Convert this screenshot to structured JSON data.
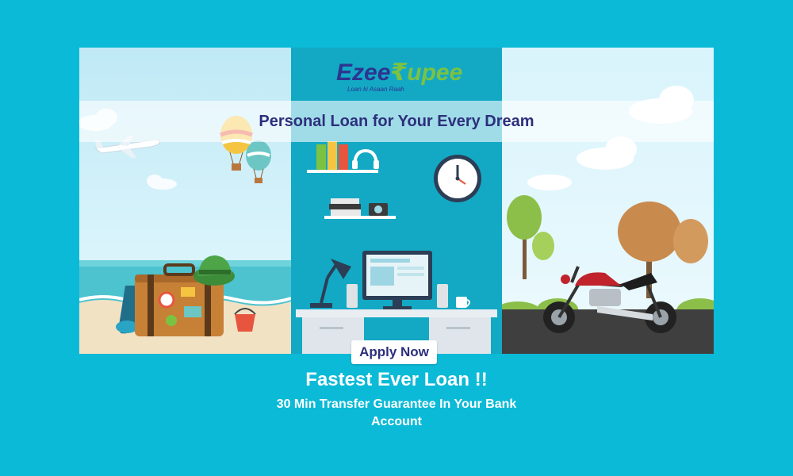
{
  "brand": {
    "logo_part1": "Ezee",
    "logo_part2": "₹upee",
    "logo_tagline": "Loan ki Asaan Raah"
  },
  "banner": {
    "tagline": "Personal Loan for Your Every Dream",
    "scenes": [
      "travel-scene",
      "home-office-scene",
      "motorbike-scene"
    ]
  },
  "cta": {
    "apply_label": "Apply Now"
  },
  "promo": {
    "headline": "Fastest Ever Loan !!",
    "subline": "30 Min Transfer Guarantee In Your Bank Account"
  },
  "colors": {
    "background": "#0bbad7",
    "navy": "#2d2f7c",
    "green": "#7cc242"
  }
}
